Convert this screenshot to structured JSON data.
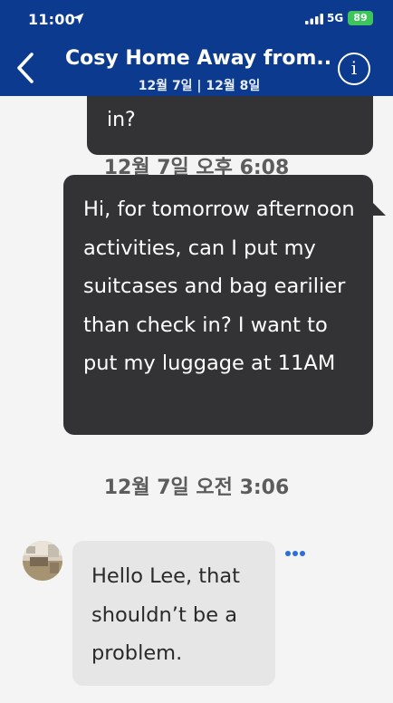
{
  "status_bar": {
    "time": "11:00",
    "network": "5G",
    "battery": "89"
  },
  "header": {
    "title": "Cosy Home Away from...",
    "dates": "12월 7일 | 12월 8일"
  },
  "messages": [
    {
      "type": "sent",
      "text": "in?"
    },
    {
      "type": "timestamp",
      "text": "12월 7일 오후 6:08"
    },
    {
      "type": "sent",
      "text": "Hi, for tomorrow afternoon activities, can I put my suitcases and bag earilier than check in? I want to put my luggage at 11AM"
    },
    {
      "type": "timestamp",
      "text": "12월 7일 오전 3:06"
    },
    {
      "type": "received",
      "text": "Hello Lee, that shouldn’t be a problem."
    }
  ],
  "colors": {
    "header_bg": "#0b3a8f",
    "sent_bubble": "#333335",
    "received_bubble": "#e6e6e6",
    "accent": "#2d6fd6",
    "battery": "#3cc55a"
  },
  "icons": [
    "location-arrow-icon",
    "signal-icon",
    "back-chevron-icon",
    "info-icon",
    "more-options-icon"
  ]
}
